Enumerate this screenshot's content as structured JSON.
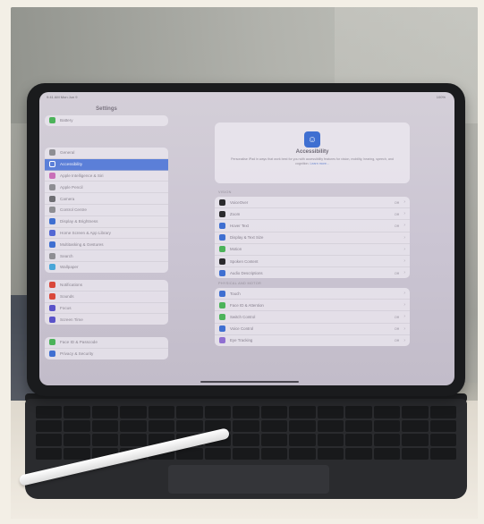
{
  "status": {
    "time": "9:41 AM  Mon Jun 9",
    "battery": "100%"
  },
  "sidebar": {
    "title": "Settings",
    "groups": [
      [
        {
          "label": "Battery",
          "color": "#4cb35a"
        }
      ],
      [
        {
          "label": "General",
          "color": "#8e8e93"
        },
        {
          "label": "Accessibility",
          "color": "#3f6fd1",
          "selected": true
        },
        {
          "label": "Apple Intelligence & Siri",
          "color": "#c96fb8"
        },
        {
          "label": "Apple Pencil",
          "color": "#8e8e93"
        },
        {
          "label": "Camera",
          "color": "#6e6e73"
        },
        {
          "label": "Control Centre",
          "color": "#8e8e93"
        },
        {
          "label": "Display & Brightness",
          "color": "#3f6fd1"
        },
        {
          "label": "Home Screen & App Library",
          "color": "#5468d4"
        },
        {
          "label": "Multitasking & Gestures",
          "color": "#3f6fd1"
        },
        {
          "label": "Search",
          "color": "#8e8e93"
        },
        {
          "label": "Wallpaper",
          "color": "#49a6d8"
        }
      ],
      [
        {
          "label": "Notifications",
          "color": "#d9483b"
        },
        {
          "label": "Sounds",
          "color": "#d9483b"
        },
        {
          "label": "Focus",
          "color": "#5a53c9"
        },
        {
          "label": "Screen Time",
          "color": "#5a53c9"
        }
      ],
      [
        {
          "label": "Face ID & Passcode",
          "color": "#4cb35a"
        },
        {
          "label": "Privacy & Security",
          "color": "#3f6fd1"
        }
      ]
    ]
  },
  "main": {
    "hero": {
      "title": "Accessibility",
      "description": "Personalise iPad in ways that work best for you with accessibility features for vision, mobility, hearing, speech, and cognition.",
      "link": "Learn more..."
    },
    "vision_label": "VISION",
    "vision": [
      {
        "label": "VoiceOver",
        "value": "Off",
        "color": "#2b2b2e"
      },
      {
        "label": "Zoom",
        "value": "Off",
        "color": "#2b2b2e"
      },
      {
        "label": "Hover Text",
        "value": "Off",
        "color": "#3f6fd1"
      },
      {
        "label": "Display & Text Size",
        "value": "",
        "color": "#3f6fd1"
      },
      {
        "label": "Motion",
        "value": "",
        "color": "#4cb35a"
      },
      {
        "label": "Spoken Content",
        "value": "",
        "color": "#2b2b2e"
      },
      {
        "label": "Audio Descriptions",
        "value": "Off",
        "color": "#3f6fd1"
      }
    ],
    "physical_label": "PHYSICAL AND MOTOR",
    "physical": [
      {
        "label": "Touch",
        "value": "",
        "color": "#3f6fd1"
      },
      {
        "label": "Face ID & Attention",
        "value": "",
        "color": "#4cb35a"
      },
      {
        "label": "Switch Control",
        "value": "Off",
        "color": "#4cb35a"
      },
      {
        "label": "Voice Control",
        "value": "Off",
        "color": "#3f6fd1"
      },
      {
        "label": "Eye Tracking",
        "value": "Off",
        "color": "#8f6fd1"
      }
    ]
  }
}
